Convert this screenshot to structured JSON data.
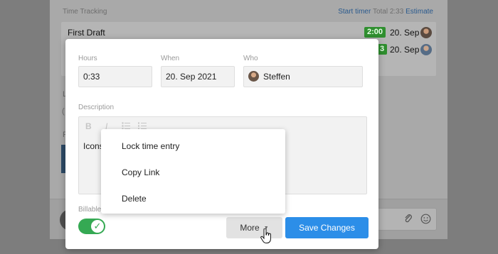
{
  "background": {
    "time_tracking": {
      "title": "Time Tracking",
      "start_timer": "Start timer",
      "total": "Total 2:33",
      "estimate": "Estimate",
      "entries": [
        {
          "name": "First Draft",
          "duration": "2:00",
          "date": "20. Sep"
        },
        {
          "name": "",
          "duration": "3",
          "date": "20. Sep"
        }
      ]
    },
    "side_labels": [
      "L",
      "(",
      "F"
    ]
  },
  "popover": {
    "hours_label": "Hours",
    "hours_value": "0:33",
    "when_label": "When",
    "when_value": "20. Sep 2021",
    "who_label": "Who",
    "who_value": "Steffen",
    "description_label": "Description",
    "description_text": "Icons",
    "toolbar": [
      "B",
      "I",
      "list",
      "list"
    ],
    "billable_label": "Billable",
    "billable_on": true,
    "more_label": "More",
    "save_label": "Save Changes"
  },
  "more_menu": {
    "items": [
      "Lock time entry",
      "Copy Link",
      "Delete"
    ]
  },
  "colors": {
    "accent": "#2c8ee8",
    "toggle_on": "#35a953",
    "duration_badge": "#2f8f2f"
  }
}
